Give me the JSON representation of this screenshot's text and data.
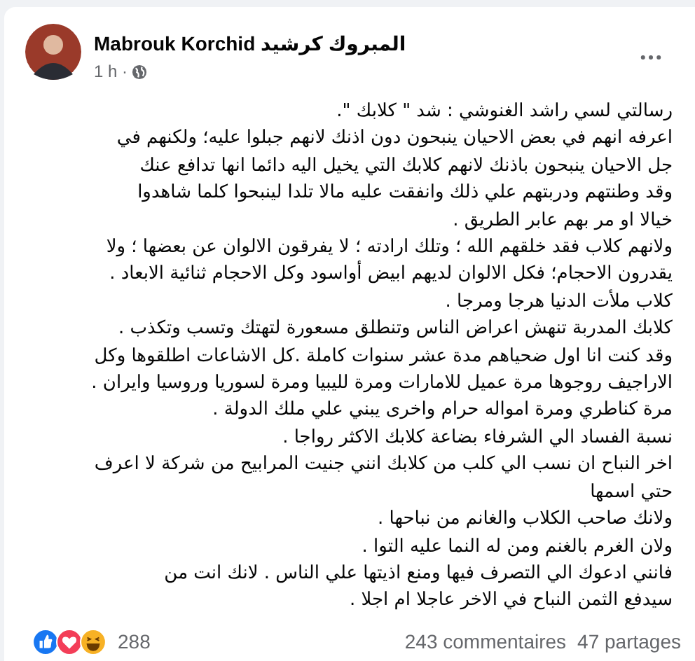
{
  "post": {
    "author": "Mabrouk Korchid المبروك كرشيد",
    "time": "1 h ·",
    "paragraphs": [
      "رسالتي  لسي راشد الغنوشي : شد \" كلابك \".",
      "اعرفه انهم في بعض الاحيان ينبحون  دون اذنك لانهم  جبلوا عليه؛ ولكنهم في\nجل الاحيان ينبحون باذنك  لانهم   كلابك  التي يخيل  اليه دائما انها تدافع عنك\nوقد وطنتهم  ودربتهم  علي ذلك وانفقت عليه مالا تلدا لينبحوا  كلما شاهدوا\nخيالا او مر  بهم عابر  الطريق .",
      "ولانهم كلاب فقد خلقهم الله ؛   وتلك ارادته ؛ لا يفرقون الالوان  عن بعضها ؛ ولا\nيقدرون الاحجام؛  فكل الالوان لديهم ابيض أواسود  وكل الاحجام ثنائية الابعاد .",
      "كلاب ملأت الدنيا هرجا ومرجا .",
      "كلابك المدربة تنهش اعراض الناس وتنطلق مسعورة لتهتك وتسب وتكذب .",
      "وقد كنت انا اول ضحياهم مدة عشر سنوات كاملة .كل الاشاعات اطلقوها وكل\nالاراجيف روجوها مرة عميل للامارات ومرة لليبيا ومرة لسوريا وروسيا وايران .",
      "مرة كناطري ومرة امواله حرام واخرى  يبني علي ملك الدولة .",
      "نسبة الفساد الي الشرفاء بضاعة كلابك الاكثر رواجا .",
      "اخر النباح ان نسب الي كلب من كلابك انني جنيت المرابيح من شركة لا اعرف\nحتي اسمها",
      "ولانك صاحب الكلاب والغانم من نباحها .",
      "ولان الغرم بالغنم ومن له النما عليه التوا .",
      "فانني  ادعوك الي التصرف فيها  ومنع اذيتها علي الناس . لانك انت من\nسيدفع الثمن النباح  في الاخر عاجلا ام  اجلا ."
    ]
  },
  "footer": {
    "reactions": [
      {
        "kind": "like"
      },
      {
        "kind": "love"
      },
      {
        "kind": "haha"
      }
    ],
    "reaction_count": "288",
    "comments": "243 commentaires",
    "shares": "47 partages"
  }
}
